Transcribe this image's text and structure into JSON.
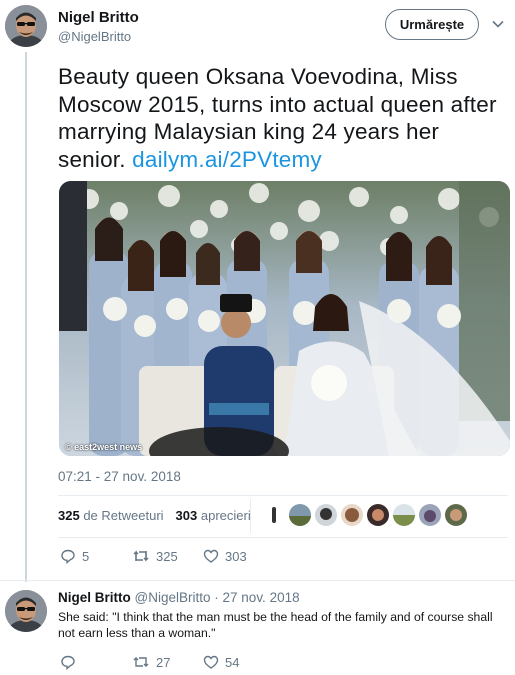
{
  "tweet": {
    "author_name": "Nigel Britto",
    "author_handle": "@NigelBritto",
    "follow_label": "Urmărește",
    "text_before_link": "Beauty queen Oksana Voevodina, Miss Moscow 2015, turns into actual queen after marrying Malaysian king 24 years her senior. ",
    "link_text": "dailym.ai/2PVtemy",
    "photo_watermark": "© east2west news",
    "timestamp": "07:21 - 27 nov. 2018",
    "retweets_count": "325",
    "retweets_label": "de Retweeturi",
    "likes_count": "303",
    "likes_label": "aprecieri",
    "actions": {
      "reply_count": "5",
      "retweet_count": "325",
      "like_count": "303"
    }
  },
  "reply": {
    "author_name": "Nigel Britto",
    "author_handle": "@NigelBritto",
    "separator": "·",
    "date": "27 nov. 2018",
    "text": "She said: \"I think that the man must be the head of the family and of course shall not earn less than a woman.\"",
    "actions": {
      "reply_count": "",
      "retweet_count": "27",
      "like_count": "54"
    }
  },
  "icons": [
    "caret-down-icon",
    "reply-icon",
    "retweet-icon",
    "like-icon"
  ],
  "colors": {
    "link": "#1b95e0",
    "secondary": "#657786",
    "border": "#e6ecf0"
  }
}
